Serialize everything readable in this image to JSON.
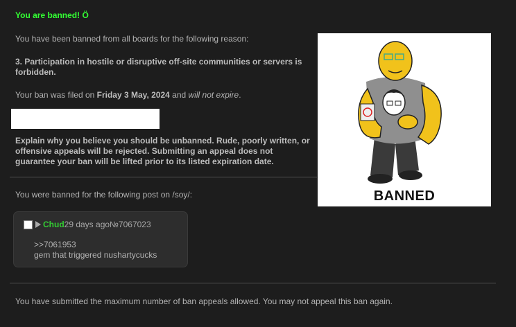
{
  "header": {
    "title": "You are banned! Ö"
  },
  "ban": {
    "reason_intro": "You have been banned from all boards for the following reason:",
    "reason": "3. Participation in hostile or disruptive off-site communities or servers is forbidden.",
    "filed_prefix": "Your ban was filed on ",
    "filed_date": "Friday 3 May, 2024",
    "filed_mid": " and ",
    "filed_expiry": "will not expire",
    "filed_suffix": ".",
    "appeal_value": "",
    "appeal_note": "Explain why you believe you should be unbanned. Rude, poorly written, or offensive appeals will be rejected. Submitting an appeal does not guarantee your ban will be lifted prior to its listed expiration date.",
    "post_intro": "You were banned for the following post on /soy/:",
    "final_note": "You have submitted the maximum number of ban appeals allowed. You may not appeal this ban again."
  },
  "post": {
    "name": "Chud",
    "time": "29 days ago",
    "number": "№7067023",
    "quote": ">>7061953",
    "text": "gem that triggered nushartycucks"
  },
  "image": {
    "caption": "BANNED"
  },
  "colors": {
    "background": "#1d1d1d",
    "title": "#33ff33",
    "name": "#33cc33",
    "text": "#b3b3b3"
  }
}
